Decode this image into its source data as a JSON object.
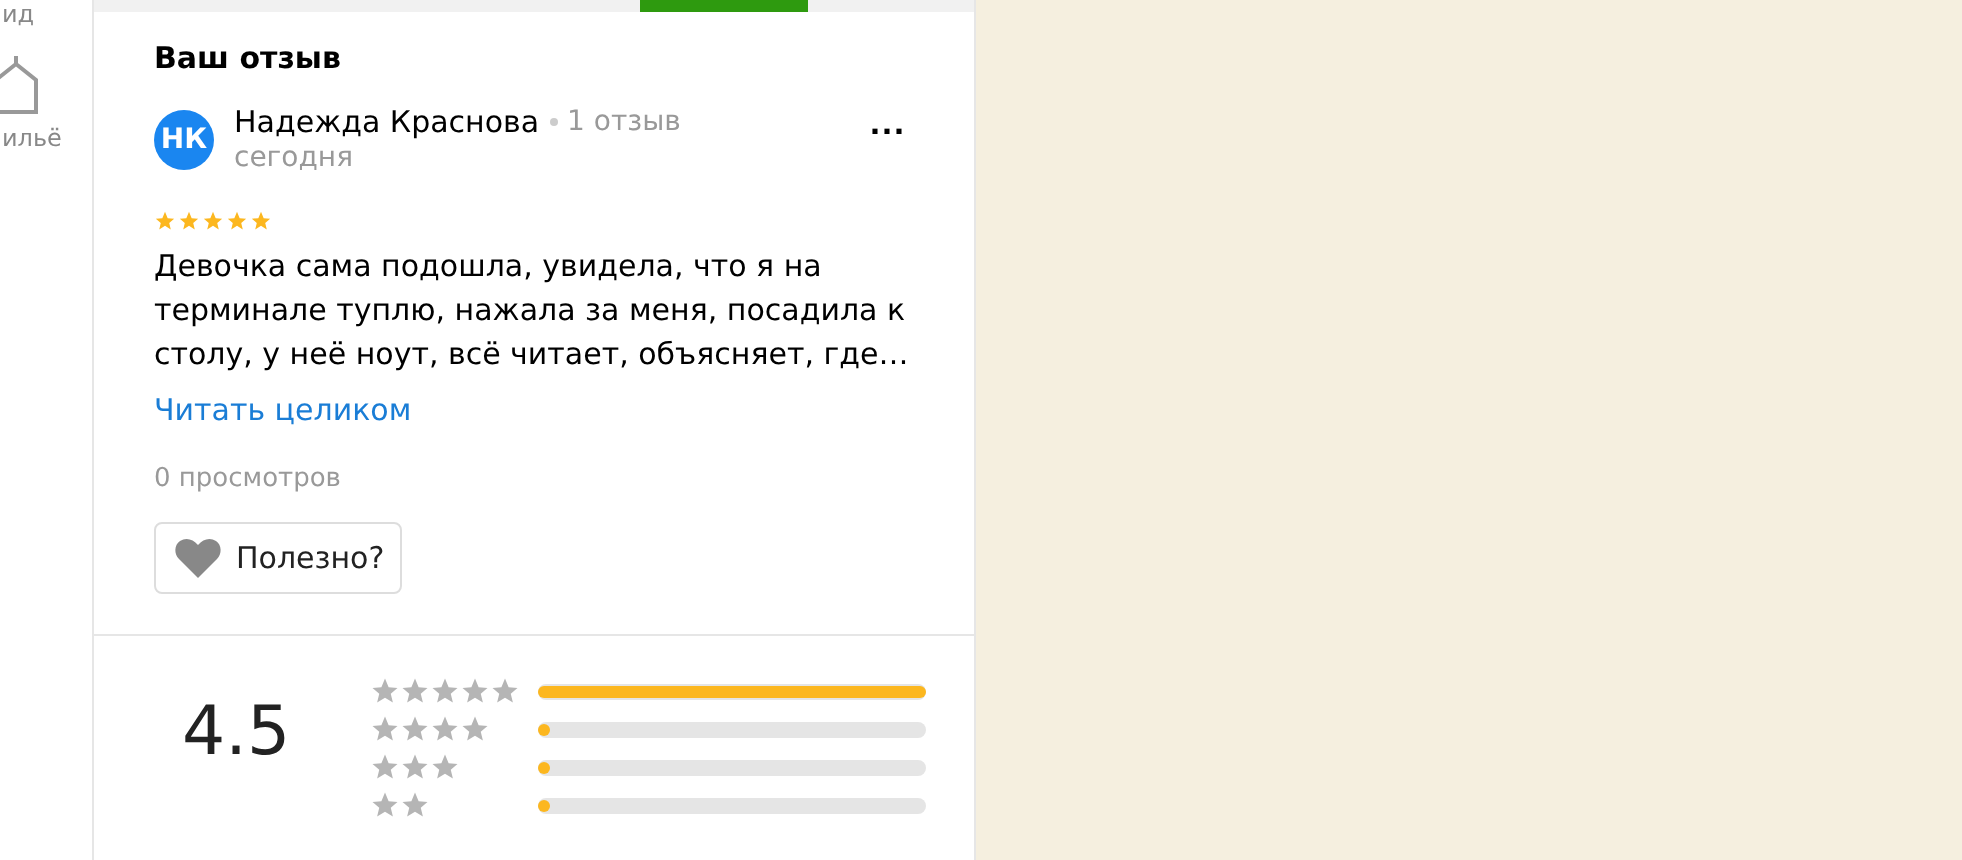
{
  "sidebar": {
    "items": [
      {
        "label": "ид"
      },
      {
        "label": "ильё"
      }
    ]
  },
  "tabs": [
    {
      "selected": false
    },
    {
      "selected": true
    },
    {
      "selected": false
    }
  ],
  "review": {
    "heading": "Ваш отзыв",
    "author": {
      "initials": "НК",
      "name": "Надежда Краснова",
      "count": "1 отзыв",
      "date": "сегодня"
    },
    "menu": "...",
    "stars": 5,
    "text": "Девочка сама подошла, увидела, что я на терминале туплю, нажала за меня, посадила к столу, у неё ноут, всё читает, объясняет, где…",
    "read_more": "Читать целиком",
    "views": "0 просмотров",
    "useful": "Полезно?"
  },
  "rating": {
    "score": "4.5",
    "rows": [
      {
        "level": 1
      },
      {
        "level": 0.02
      },
      {
        "level": 0.01
      },
      {
        "level": 0.01
      }
    ]
  }
}
